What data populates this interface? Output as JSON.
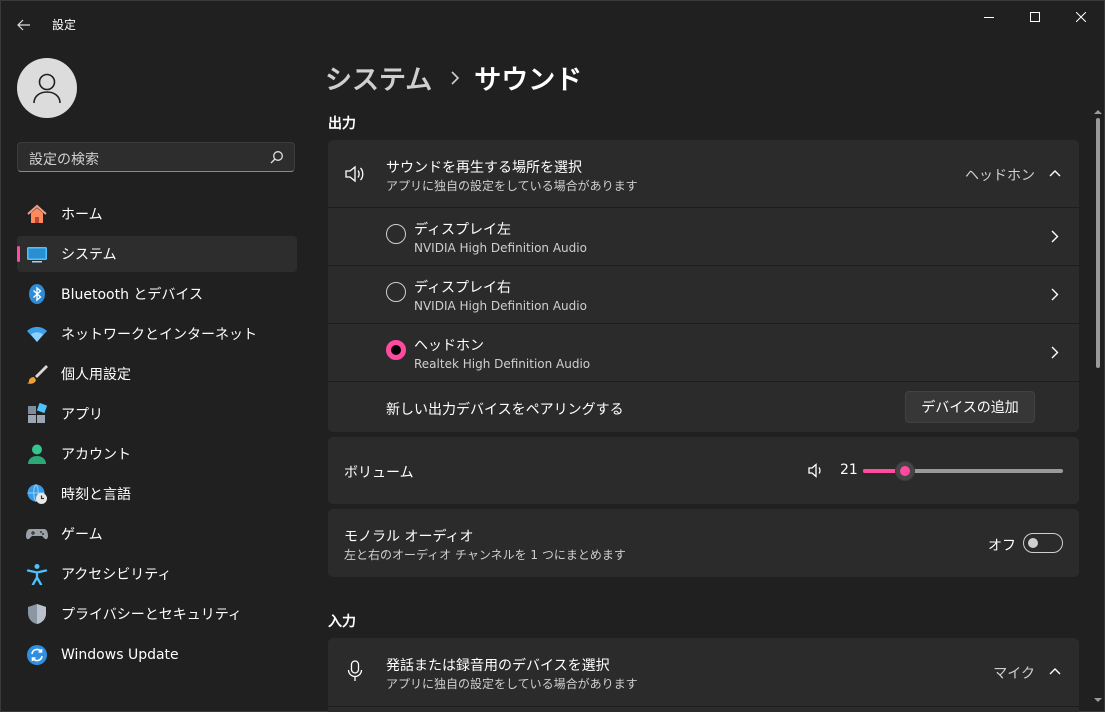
{
  "app": {
    "title": "設定"
  },
  "search": {
    "placeholder": "設定の検索"
  },
  "sidebar": {
    "items": [
      {
        "label": "ホーム",
        "icon": "home-icon"
      },
      {
        "label": "システム",
        "icon": "system-display-icon",
        "selected": true
      },
      {
        "label": "Bluetooth とデバイス",
        "icon": "bluetooth-icon"
      },
      {
        "label": "ネットワークとインターネット",
        "icon": "wifi-icon"
      },
      {
        "label": "個人用設定",
        "icon": "brush-icon"
      },
      {
        "label": "アプリ",
        "icon": "apps-icon"
      },
      {
        "label": "アカウント",
        "icon": "account-icon"
      },
      {
        "label": "時刻と言語",
        "icon": "globe-clock-icon"
      },
      {
        "label": "ゲーム",
        "icon": "gamepad-icon"
      },
      {
        "label": "アクセシビリティ",
        "icon": "accessibility-icon"
      },
      {
        "label": "プライバシーとセキュリティ",
        "icon": "shield-icon"
      },
      {
        "label": "Windows Update",
        "icon": "update-icon"
      }
    ]
  },
  "breadcrumb": {
    "parent": "システム",
    "current": "サウンド"
  },
  "output": {
    "section_title": "出力",
    "select_title": "サウンドを再生する場所を選択",
    "select_subtitle": "アプリに独自の設定をしている場合があります",
    "selected_device": "ヘッドホン",
    "devices": [
      {
        "name": "ディスプレイ左",
        "driver": "NVIDIA High Definition Audio",
        "selected": false
      },
      {
        "name": "ディスプレイ右",
        "driver": "NVIDIA High Definition Audio",
        "selected": false
      },
      {
        "name": "ヘッドホン",
        "driver": "Realtek High Definition Audio",
        "selected": true
      }
    ],
    "pair_label": "新しい出力デバイスをペアリングする",
    "add_device_button": "デバイスの追加"
  },
  "volume": {
    "label": "ボリューム",
    "value": "21",
    "level": 0.21
  },
  "mono": {
    "title": "モノラル オーディオ",
    "subtitle": "左と右のオーディオ チャンネルを 1 つにまとめます",
    "state_label": "オフ",
    "enabled": false
  },
  "input": {
    "section_title": "入力",
    "select_title": "発話または録音用のデバイスを選択",
    "select_subtitle": "アプリに独自の設定をしている場合があります",
    "selected_device": "マイク"
  },
  "colors": {
    "accent": "#ff4aa0",
    "background": "#202020",
    "card": "#2b2b2b"
  }
}
